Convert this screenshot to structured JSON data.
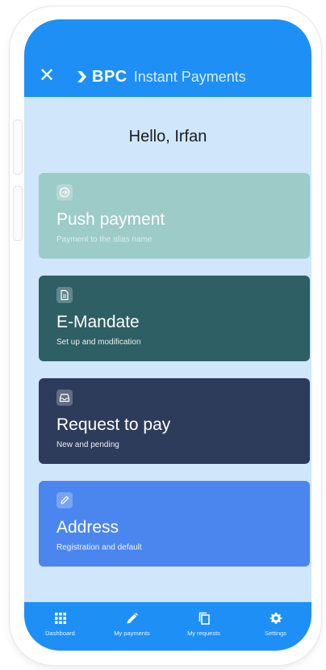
{
  "header": {
    "close_icon": "close-icon",
    "brand_name": "BPC",
    "brand_subtitle": "Instant Payments"
  },
  "greeting": "Hello, Irfan",
  "cards": [
    {
      "title": "Push payment",
      "subtitle": "Payment to the alias name",
      "icon": "arrow-circle-icon",
      "color": "#9ccbc8"
    },
    {
      "title": "E-Mandate",
      "subtitle": "Set up and modification",
      "icon": "document-icon",
      "color": "#2d5f65"
    },
    {
      "title": "Request to pay",
      "subtitle": "New and pending",
      "icon": "inbox-icon",
      "color": "#2e3c5b"
    },
    {
      "title": "Address",
      "subtitle": "Registration and default",
      "icon": "pencil-icon",
      "color": "#4b86ef"
    }
  ],
  "tabs": [
    {
      "label": "Dashboard",
      "icon": "grid-icon"
    },
    {
      "label": "My payments",
      "icon": "pencil-icon"
    },
    {
      "label": "My requests",
      "icon": "copy-icon"
    },
    {
      "label": "Settings",
      "icon": "gear-icon"
    }
  ],
  "colors": {
    "primary": "#1e8ff5",
    "background": "#cfe6fb"
  }
}
